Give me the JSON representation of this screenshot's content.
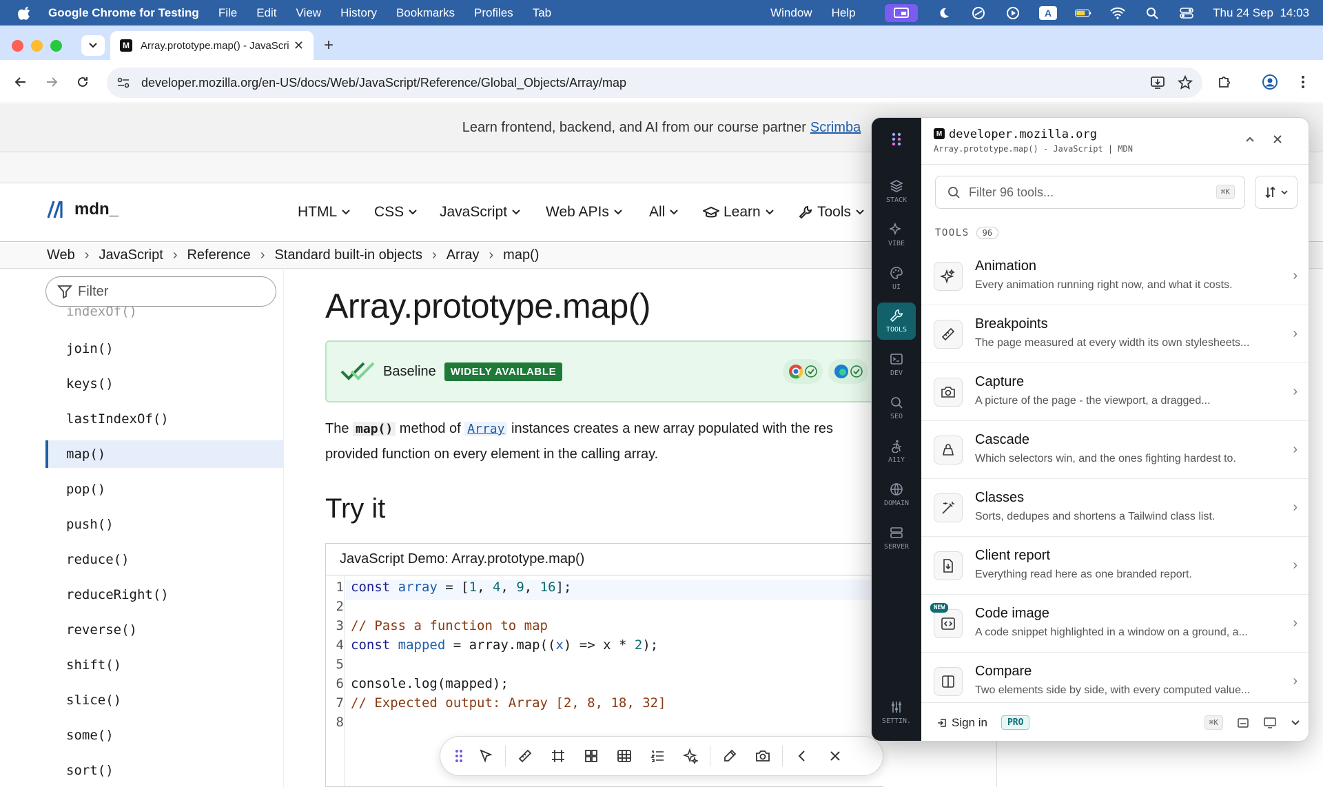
{
  "menubar": {
    "app": "Google Chrome for Testing",
    "items": [
      "File",
      "Edit",
      "View",
      "History",
      "Bookmarks",
      "Profiles",
      "Tab",
      "Window",
      "Help"
    ],
    "date_time": "Thu 24 Sep  14:03"
  },
  "browser": {
    "tab_title": "Array.prototype.map() - JavaScript | MDN",
    "url": "developer.mozilla.org/en-US/docs/Web/JavaScript/Reference/Global_Objects/Array/map"
  },
  "page": {
    "promo_text": "Learn frontend, backend, and AI from our course partner",
    "promo_link": "Scrimba",
    "logo_text": "mdn_",
    "nav": [
      "HTML",
      "CSS",
      "JavaScript",
      "Web APIs",
      "All",
      "Learn",
      "Tools"
    ],
    "breadcrumbs": [
      "Web",
      "JavaScript",
      "Reference",
      "Standard built-in objects",
      "Array",
      "map()"
    ],
    "sidebar_filter_placeholder": "Filter",
    "sidebar_items": [
      "indexOf()",
      "join()",
      "keys()",
      "lastIndexOf()",
      "map()",
      "pop()",
      "push()",
      "reduce()",
      "reduceRight()",
      "reverse()",
      "shift()",
      "slice()",
      "some()",
      "sort()"
    ],
    "selected_item": "map()",
    "title": "Array.prototype.map()",
    "baseline_label": "Baseline",
    "baseline_badge": "WIDELY AVAILABLE",
    "desc_pre": "The",
    "desc_code": "map()",
    "desc_mid": "method of",
    "desc_link": "Array",
    "desc_post": "instances creates a new array populated with the res",
    "desc_line2": "provided function on every element in the calling array.",
    "try_it": "Try it",
    "demo_title": "JavaScript Demo: Array.prototype.map()",
    "line_numbers": [
      "1",
      "2",
      "3",
      "4",
      "5",
      "6",
      "7",
      "8"
    ]
  },
  "panel": {
    "domain": "developer.mozilla.org",
    "subtitle": "Array.prototype.map() - JavaScript | MDN",
    "search_placeholder": "Filter 96 tools...",
    "search_kbd": "⌘K",
    "tools_label": "TOOLS",
    "tools_count": "96",
    "rail": [
      "STACK",
      "VIBE",
      "UI",
      "TOOLS",
      "DEV",
      "SEO",
      "A11Y",
      "DOMAIN",
      "SERVER",
      "SETTIN."
    ],
    "active_rail": "TOOLS",
    "tools": [
      {
        "name": "Animation",
        "desc": "Every animation running right now, and what it costs."
      },
      {
        "name": "Breakpoints",
        "desc": "The page measured at every width its own stylesheets..."
      },
      {
        "name": "Capture",
        "desc": "A picture of the page - the viewport, a dragged..."
      },
      {
        "name": "Cascade",
        "desc": "Which selectors win, and the ones fighting hardest to."
      },
      {
        "name": "Classes",
        "desc": "Sorts, dedupes and shortens a Tailwind class list."
      },
      {
        "name": "Client report",
        "desc": "Everything read here as one branded report."
      },
      {
        "name": "Code image",
        "desc": "A code snippet highlighted in a window on a ground, a..."
      },
      {
        "name": "Compare",
        "desc": "Two elements side by side, with every computed value..."
      }
    ],
    "new_badge": "NEW",
    "sign_in": "Sign in",
    "pro": "PRO",
    "footer_kbd": "⌘K"
  }
}
